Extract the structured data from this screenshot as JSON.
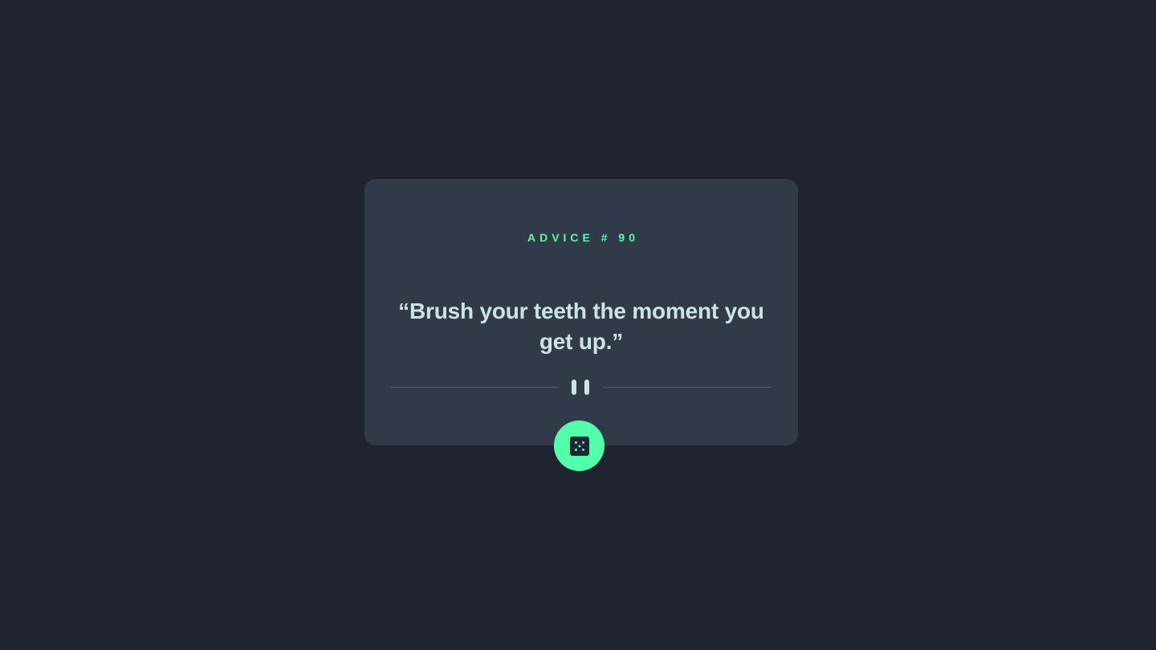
{
  "advice": {
    "id_label": "ADVICE # 90",
    "quote": "“Brush your teeth the moment you get up.”"
  },
  "divider": {
    "icon": "pause-icon"
  },
  "generate_button": {
    "icon": "dice-icon"
  },
  "colors": {
    "background": "#1f2430",
    "card": "#313a49",
    "accent": "#53ffab",
    "text": "#cee3e9",
    "divider": "#4f5d74"
  }
}
